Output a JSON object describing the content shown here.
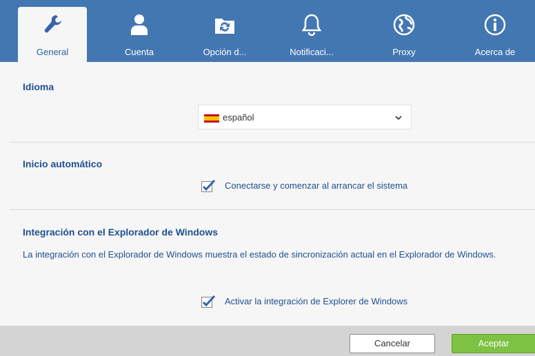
{
  "tabs": [
    {
      "label": "General",
      "icon": "wrench-icon",
      "active": true
    },
    {
      "label": "Cuenta",
      "icon": "user-icon"
    },
    {
      "label": "Opción d...",
      "icon": "sync-folder-icon"
    },
    {
      "label": "Notificaci...",
      "icon": "bell-icon"
    },
    {
      "label": "Proxy",
      "icon": "globe-icon"
    },
    {
      "label": "Acerca de",
      "icon": "info-icon"
    }
  ],
  "language": {
    "title": "Idioma",
    "selected": "español",
    "flag": "spain-flag-icon"
  },
  "autostart": {
    "title": "Inicio automático",
    "checkbox_label": "Conectarse y comenzar al arrancar el sistema",
    "checked": true
  },
  "explorer": {
    "title": "Integración con el Explorador de Windows",
    "description": "La integración con el Explorador de Windows muestra el estado de sincronización actual en el Explorador de Windows.",
    "checkbox_label": "Activar la integración de Explorer de Windows",
    "checked": true
  },
  "footer": {
    "cancel_label": "Cancelar",
    "ok_label": "Aceptar"
  },
  "colors": {
    "tabbar": "#4377b2",
    "accent_text": "#1f4f8f",
    "ok_button": "#7dc242"
  }
}
